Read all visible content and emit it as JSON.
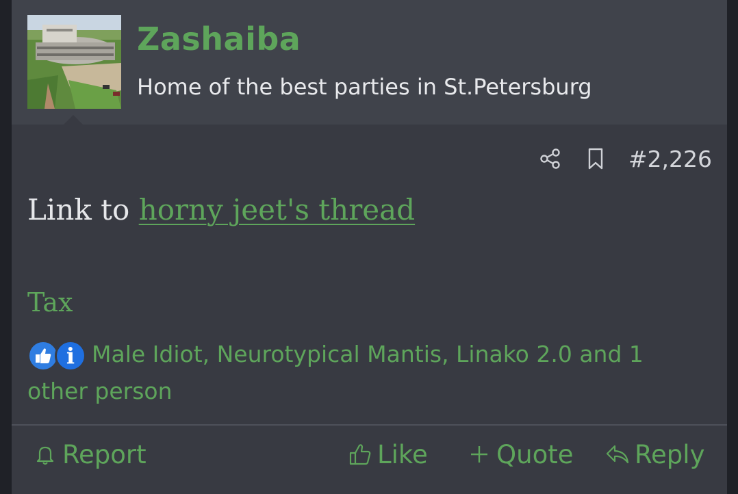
{
  "user": {
    "name": "Zashaiba",
    "title": "Home of the best parties in St.Petersburg"
  },
  "post": {
    "number": "#2,226",
    "body_prefix": "Link to",
    "link_text": "horny jeet's thread",
    "signature": "Tax"
  },
  "reactions": {
    "text": "Male Idiot, Neurotypical Mantis, Linako 2.0 and 1 other person",
    "icons": [
      "thumbs-up-reaction-icon",
      "info-reaction-icon"
    ]
  },
  "actions": {
    "report": "Report",
    "like": "Like",
    "quote": "Quote",
    "reply": "Reply"
  },
  "colors": {
    "accent_green": "#5ea55b",
    "post_bg": "#383a42",
    "header_bg": "#40434b"
  }
}
